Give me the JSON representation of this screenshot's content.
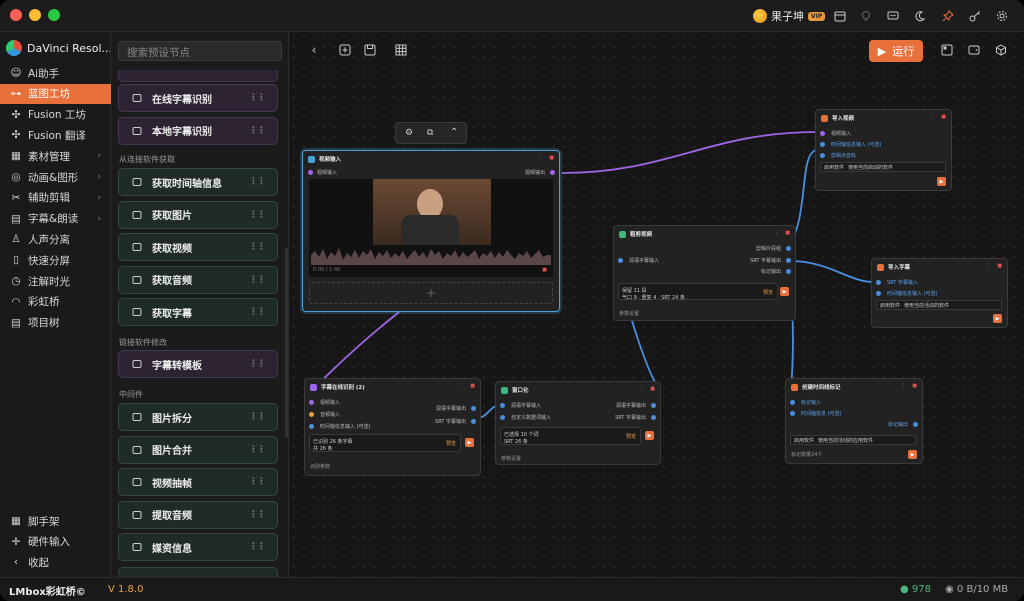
{
  "app": {
    "user_name": "果子坤",
    "vip": "VIP",
    "brand": "DaVinci Resol...",
    "version": "V 1.8.0",
    "footer_brand": "LMbox彩虹桥©"
  },
  "titlebar_icons": [
    "calendar-icon",
    "lightbulb-icon",
    "chat-icon",
    "moon-icon",
    "pin-icon",
    "key-icon",
    "gear-icon"
  ],
  "sidebar": {
    "items": [
      {
        "label": "Ai助手",
        "icon": "robot-icon",
        "chevron": false
      },
      {
        "label": "蓝图工坊",
        "icon": "blueprint-icon",
        "chevron": false,
        "active": true
      },
      {
        "label": "Fusion 工坊",
        "icon": "fusion-icon",
        "chevron": false
      },
      {
        "label": "Fusion 翻译",
        "icon": "translate-icon",
        "chevron": false
      },
      {
        "label": "素材管理",
        "icon": "grid-icon",
        "chevron": true
      },
      {
        "label": "动画&图形",
        "icon": "animation-icon",
        "chevron": true
      },
      {
        "label": "辅助剪辑",
        "icon": "edit-icon",
        "chevron": true
      },
      {
        "label": "字幕&朗读",
        "icon": "subtitle-icon",
        "chevron": true
      },
      {
        "label": "人声分离",
        "icon": "person-icon",
        "chevron": false
      },
      {
        "label": "快速分屏",
        "icon": "split-icon",
        "chevron": false
      },
      {
        "label": "注解时光",
        "icon": "clock-icon",
        "chevron": false
      },
      {
        "label": "彩虹桥",
        "icon": "rainbow-icon",
        "chevron": false
      },
      {
        "label": "项目树",
        "icon": "tree-icon",
        "chevron": false
      }
    ],
    "bottom": [
      {
        "label": "脚手架",
        "icon": "scaffold-icon"
      },
      {
        "label": "硬件输入",
        "icon": "joystick-icon"
      },
      {
        "label": "收起",
        "icon": "chevron-left-icon"
      }
    ]
  },
  "library": {
    "search_placeholder": "搜索预设节点",
    "top_items": [
      {
        "label": "在线字幕识别"
      },
      {
        "label": "本地字幕识别"
      }
    ],
    "section1": "从连接软件获取",
    "section1_items": [
      {
        "label": "获取时间轴信息"
      },
      {
        "label": "获取图片"
      },
      {
        "label": "获取视频"
      },
      {
        "label": "获取音频"
      },
      {
        "label": "获取字幕"
      }
    ],
    "section2": "链接软件修改",
    "section2_items": [
      {
        "label": "字幕转模板"
      }
    ],
    "section3": "中间件",
    "section3_items": [
      {
        "label": "图片拆分"
      },
      {
        "label": "图片合并"
      },
      {
        "label": "视频抽帧"
      },
      {
        "label": "提取音频"
      },
      {
        "label": "媒资信息"
      }
    ]
  },
  "toolbar": {
    "run_label": "运行"
  },
  "nodes": {
    "video_input": {
      "title": "视频输入",
      "in": "视频输入",
      "out": "视频输出",
      "time": "0:00 / 1:40"
    },
    "import_video": {
      "title": "导入视频",
      "ports": [
        "视频输入",
        "时间轴信息输入 (可选)",
        "剪辑点音轨"
      ],
      "app_label": "启用软件",
      "app_value": "使用当前启动的软件"
    },
    "subtitle_clip": {
      "title": "粗剪视频",
      "out1": "剪辑片段组",
      "in1": "润语字幕输入",
      "out2": "SRT 字幕输出",
      "out3": "标记输出",
      "box_line1": "保留 11 段",
      "box_line2": "气口 9 · 重复 4 · SRT 24 条",
      "preview": "预览",
      "settings": "参数设置"
    },
    "import_subtitle": {
      "title": "导入字幕",
      "ports": [
        "SRT 字幕输入",
        "时间轴信息输入 (可选)"
      ],
      "app_label": "启用软件",
      "app_value": "使用当前活动的软件"
    },
    "online_asr": {
      "title": "字幕在线识别 (2)",
      "ins": [
        "视频输入",
        "音频输入",
        "时间轴信息输入 (可选)"
      ],
      "outs": [
        "润语字幕输出",
        "SRT 字幕输出"
      ],
      "box_line1": "已识别 26 条字幕",
      "box_line2": "共 26 条",
      "preview": "预览",
      "settings": "识别参数"
    },
    "window": {
      "title": "窗口化",
      "ins": [
        "润语字幕输入",
        "自定义数据词输入"
      ],
      "outs": [
        "润语字幕输出",
        "SRT 字幕输出"
      ],
      "box_line1": "已选择 10 个词",
      "box_line2": "SRT 26 条",
      "preview": "预览",
      "settings": "参数设置"
    },
    "timeline_marker": {
      "title": "创建时间线标记",
      "ins": [
        "标记输入",
        "时间轴信息 (可选)"
      ],
      "out": "标记输出",
      "app_label": "启用软件",
      "app_value": "使用当前活动的应用软件",
      "count": "标记数量24个"
    }
  },
  "status": {
    "count": "978",
    "memory": "0 B/10 MB"
  },
  "colors": {
    "accent": "#e8703a",
    "link_purple": "#a066e8",
    "link_blue": "#4a8ee0"
  }
}
